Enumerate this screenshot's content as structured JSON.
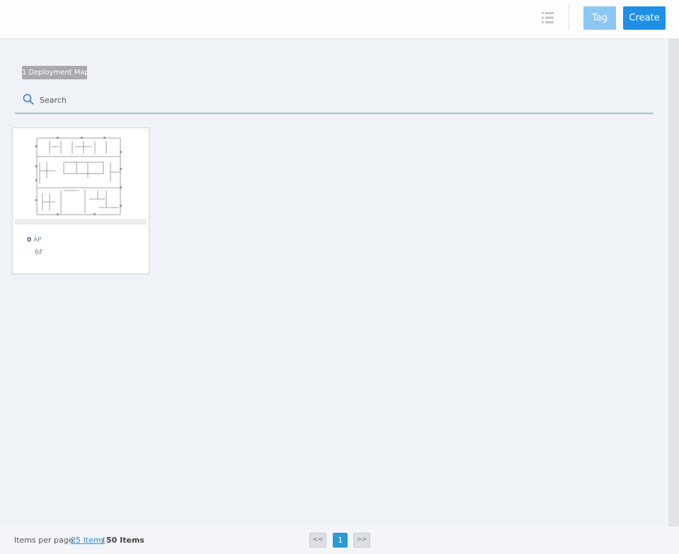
{
  "toolbar": {
    "list_view_icon": "list-view-icon",
    "tag_label": "Tag",
    "create_label": "Create",
    "tag_color": "#8cc7f4",
    "create_color": "#1f8fe7"
  },
  "summary": {
    "count_label": "1 Deployment Map"
  },
  "search": {
    "icon": "search-icon",
    "placeholder": "Search"
  },
  "maps": [
    {
      "ap_count": "0",
      "ap_label": "AP",
      "floor": "6F"
    }
  ],
  "footer": {
    "items_per_page_label": "Items per page:",
    "items_per_page_value": "25 Items",
    "separator": "/",
    "total": "50 Items",
    "prev_label": "<<",
    "current_page": "1",
    "next_label": ">>",
    "accent": "#2a9ad6"
  }
}
